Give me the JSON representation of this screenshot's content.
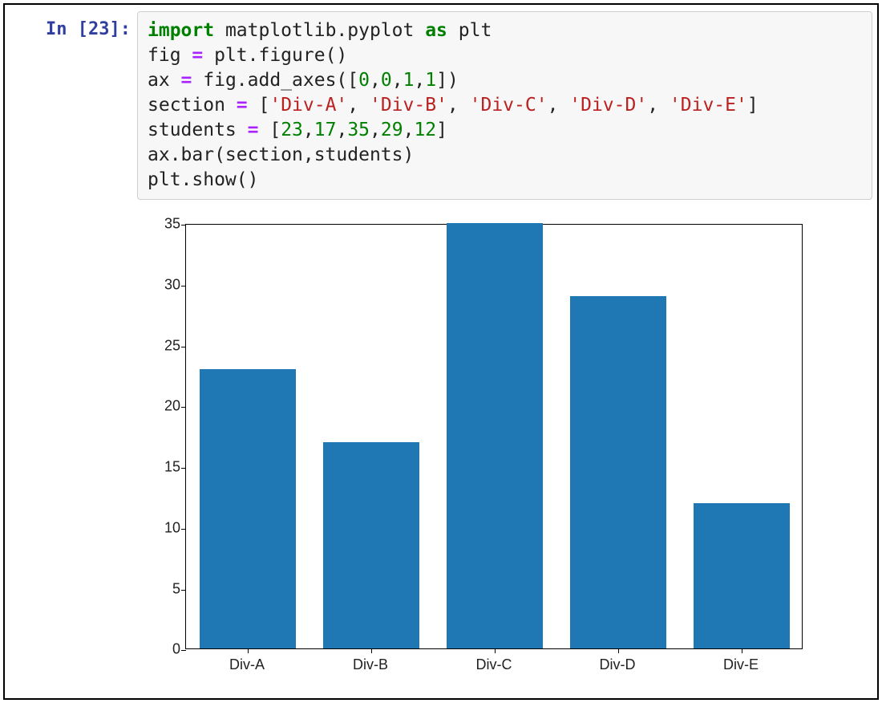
{
  "prompt": {
    "in_text": "In",
    "open_bracket": "[",
    "number": "23",
    "close_bracket": "]",
    "colon": ":"
  },
  "code": {
    "l1_kw_import": "import",
    "l1_mod": " matplotlib.pyplot ",
    "l1_kw_as": "as",
    "l1_alias": " plt",
    "l2_a": "fig ",
    "l2_eq": "=",
    "l2_b": " plt.figure()",
    "l3_a": "ax ",
    "l3_eq": "=",
    "l3_b": " fig.add_axes([",
    "l3_n0": "0",
    "l3_c1": ",",
    "l3_n1": "0",
    "l3_c2": ",",
    "l3_n2": "1",
    "l3_c3": ",",
    "l3_n3": "1",
    "l3_c4": "])",
    "l4_a": "section ",
    "l4_eq": "=",
    "l4_b": " [",
    "l4_s0": "'Div-A'",
    "l4_c1": ", ",
    "l4_s1": "'Div-B'",
    "l4_c2": ", ",
    "l4_s2": "'Div-C'",
    "l4_c3": ", ",
    "l4_s3": "'Div-D'",
    "l4_c4": ", ",
    "l4_s4": "'Div-E'",
    "l4_c5": "]",
    "l5_a": "students ",
    "l5_eq": "=",
    "l5_b": " [",
    "l5_n0": "23",
    "l5_c1": ",",
    "l5_n1": "17",
    "l5_c2": ",",
    "l5_n2": "35",
    "l5_c3": ",",
    "l5_n3": "29",
    "l5_c4": ",",
    "l5_n4": "12",
    "l5_c5": "]",
    "l6": "ax.bar(section,students)",
    "l7": "plt.show()"
  },
  "chart_data": {
    "type": "bar",
    "categories": [
      "Div-A",
      "Div-B",
      "Div-C",
      "Div-D",
      "Div-E"
    ],
    "values": [
      23,
      17,
      35,
      29,
      12
    ],
    "ylim": [
      0,
      35
    ],
    "yticks": [
      0,
      5,
      10,
      15,
      20,
      25,
      30,
      35
    ],
    "bar_color": "#1f77b4",
    "title": "",
    "xlabel": "",
    "ylabel": ""
  }
}
